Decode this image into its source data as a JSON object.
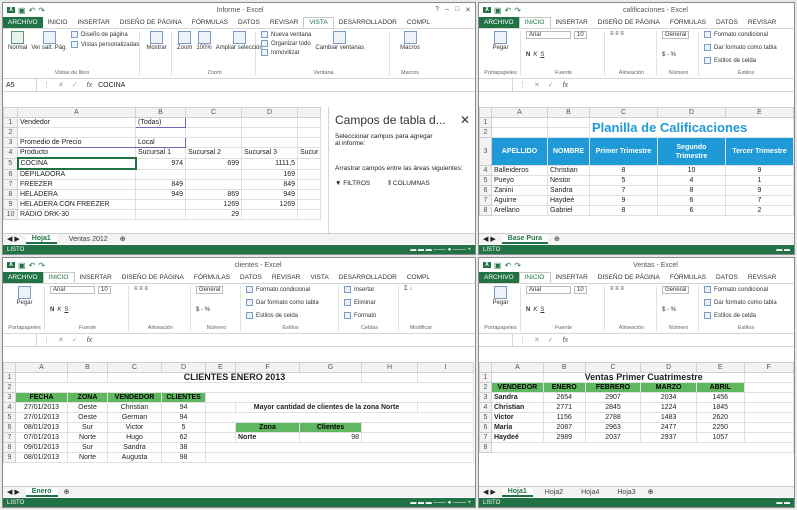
{
  "windows": {
    "w1": {
      "title": "Informe - Excel",
      "tabs": [
        "ARCHIVO",
        "INICIO",
        "INSERTAR",
        "DISEÑO DE PÁGINA",
        "FÓRMULAS",
        "DATOS",
        "REVISAR",
        "VISTA",
        "DESARROLLADOR",
        "COMPL"
      ],
      "active_tab": "VISTA",
      "ribbon": {
        "b1": "Normal",
        "b2": "Ver salt. Pág.",
        "b3": "Diseño de página",
        "b4": "Vistas personalizadas",
        "b5": "Mostrar",
        "b6": "Zoom",
        "b7": "100%",
        "b8": "Ampliar selección",
        "b9": "Nueva ventana",
        "b10": "Organizar todo",
        "b11": "Inmovilizar",
        "b12": "Cambiar ventanas",
        "b13": "Macros",
        "g1": "Vistas de libro",
        "g2": "Zoom",
        "g3": "Ventana",
        "g4": "Macros"
      },
      "namebox": "A5",
      "formula": "COCINA",
      "cols": [
        "A",
        "B",
        "C",
        "D"
      ],
      "rows": [
        [
          "1",
          "Vendedor",
          "(Todas)",
          "",
          ""
        ],
        [
          "2",
          "",
          "",
          "",
          ""
        ],
        [
          "3",
          "Promedio de Precio",
          "Local",
          "",
          ""
        ],
        [
          "4",
          "Producto",
          "Sucursal 1",
          "Sucursal 2",
          "Sucursal 3"
        ],
        [
          "5",
          "COCINA",
          "974",
          "699",
          "1111,5"
        ],
        [
          "6",
          "DEPILADORA",
          "",
          "",
          "169"
        ],
        [
          "7",
          "FREEZER",
          "849",
          "",
          "849"
        ],
        [
          "8",
          "HELADERA",
          "949",
          "869",
          "949"
        ],
        [
          "9",
          "HELADERA CON FREEZER",
          "",
          "1269",
          "1269"
        ],
        [
          "10",
          "RADIO DRK-30",
          "",
          "29",
          ""
        ]
      ],
      "last_col_hdr": "Sucur",
      "pane": {
        "title": "Campos de tabla d...",
        "sub": "Seleccionar campos para agregar al informe:",
        "drag": "Arrastrar campos entre las áreas siguientes:",
        "filters": "FILTROS",
        "columns": "COLUMNAS"
      },
      "sheet_tabs": [
        "Hoja1",
        "Ventas 2012"
      ],
      "status": "LISTO"
    },
    "w2": {
      "title": "calificaciones - Excel",
      "tabs": [
        "ARCHIVO",
        "INICIO",
        "INSERTAR",
        "DISEÑO DE PÁGINA",
        "FÓRMULAS",
        "DATOS",
        "REVISAR"
      ],
      "active_tab": "INICIO",
      "ribbon": {
        "paste": "Pegar",
        "font": "Arial",
        "size": "10",
        "numfmt": "General",
        "cf": "Formato condicional",
        "table": "Dar formato como tabla",
        "styles": "Estilos de celda",
        "g1": "Portapapeles",
        "g2": "Fuente",
        "g3": "Alineación",
        "g4": "Número",
        "g5": "Estilos"
      },
      "namebox": "",
      "formula": "",
      "cols": [
        "A",
        "B",
        "C",
        "D",
        "E"
      ],
      "heading": "Planilla de Calificaciones",
      "headers": [
        "APELLIDO",
        "NOMBRE",
        "Primer Trimestre",
        "Segundo Trimestre",
        "Tercer Trimestre"
      ],
      "rows": [
        [
          "Balleideros",
          "Christian",
          "8",
          "10",
          "9"
        ],
        [
          "Pueyo",
          "Nestor",
          "5",
          "4",
          "1"
        ],
        [
          "Zanini",
          "Sandra",
          "7",
          "8",
          "9"
        ],
        [
          "Aguirre",
          "Haydeé",
          "9",
          "6",
          "7"
        ],
        [
          "Arellano",
          "Gabriel",
          "8",
          "6",
          "2"
        ]
      ],
      "sheet_tabs": [
        "Base Pura"
      ],
      "status": "LISTO"
    },
    "w3": {
      "title": "clientes - Excel",
      "tabs": [
        "ARCHIVO",
        "INICIO",
        "INSERTAR",
        "DISEÑO DE PÁGINA",
        "FÓRMULAS",
        "DATOS",
        "REVISAR",
        "VISTA",
        "DESARROLLADOR",
        "COMPL"
      ],
      "active_tab": "INICIO",
      "ribbon": {
        "paste": "Pegar",
        "font": "Arial",
        "size": "10",
        "numfmt": "General",
        "cf": "Formato condicional",
        "table": "Dar formato como tabla",
        "styles": "Estilos de celda",
        "ins": "Insertar",
        "del": "Eliminar",
        "fmt": "Formato",
        "g1": "Portapapeles",
        "g2": "Fuente",
        "g3": "Alineación",
        "g4": "Número",
        "g5": "Estilos",
        "g6": "Celdas",
        "g7": "Modificar"
      },
      "cols": [
        "A",
        "B",
        "C",
        "D",
        "E",
        "F",
        "G",
        "H",
        "I"
      ],
      "heading": "CLIENTES ENERO 2013",
      "headers": [
        "FECHA",
        "ZONA",
        "VENDEDOR",
        "CLIENTES"
      ],
      "rows": [
        [
          "27/01/2013",
          "Oeste",
          "Christian",
          "94"
        ],
        [
          "27/01/2013",
          "Oeste",
          "German",
          "94"
        ],
        [
          "08/01/2013",
          "Sur",
          "Victor",
          "5"
        ],
        [
          "07/01/2013",
          "Norte",
          "Hugo",
          "62"
        ],
        [
          "09/01/2013",
          "Sur",
          "Sandra",
          "38"
        ],
        [
          "08/01/2013",
          "Norte",
          "Augusta",
          "98"
        ]
      ],
      "side_title": "Mayor cantidad de clientes de la zona Norte",
      "side_h1": "Zona",
      "side_h2": "Clientes",
      "side_v1": "Norte",
      "side_v2": "98",
      "sheet_tabs": [
        "Enero"
      ],
      "status": "LISTO"
    },
    "w4": {
      "title": "Ventas - Excel",
      "tabs": [
        "ARCHIVO",
        "INICIO",
        "INSERTAR",
        "DISEÑO DE PÁGINA",
        "FÓRMULAS",
        "DATOS",
        "REVISAR"
      ],
      "active_tab": "INICIO",
      "ribbon": {
        "paste": "Pegar",
        "font": "Arial",
        "size": "10",
        "numfmt": "General",
        "cf": "Formato condicional",
        "table": "Dar formato como tabla",
        "styles": "Estilos de celda",
        "g1": "Portapapeles",
        "g2": "Fuente",
        "g3": "Alineación",
        "g4": "Número",
        "g5": "Estilos"
      },
      "cols": [
        "A",
        "B",
        "C",
        "D",
        "E",
        "F"
      ],
      "heading": "Ventas Primer Cuatrimestre",
      "headers": [
        "VENDEDOR",
        "ENERO",
        "FEBRERO",
        "MARZO",
        "ABRIL"
      ],
      "rows": [
        [
          "Sandra",
          "2654",
          "2907",
          "2034",
          "1456"
        ],
        [
          "Christian",
          "2771",
          "2845",
          "1224",
          "1845"
        ],
        [
          "Victor",
          "1156",
          "2788",
          "1483",
          "2620"
        ],
        [
          "María",
          "2087",
          "2963",
          "2477",
          "2250"
        ],
        [
          "Haydeé",
          "2989",
          "2037",
          "2937",
          "1057"
        ]
      ],
      "sheet_tabs": [
        "Hoja1",
        "Hoja2",
        "Hoja4",
        "Hoja3"
      ],
      "status": "LISTO"
    }
  }
}
